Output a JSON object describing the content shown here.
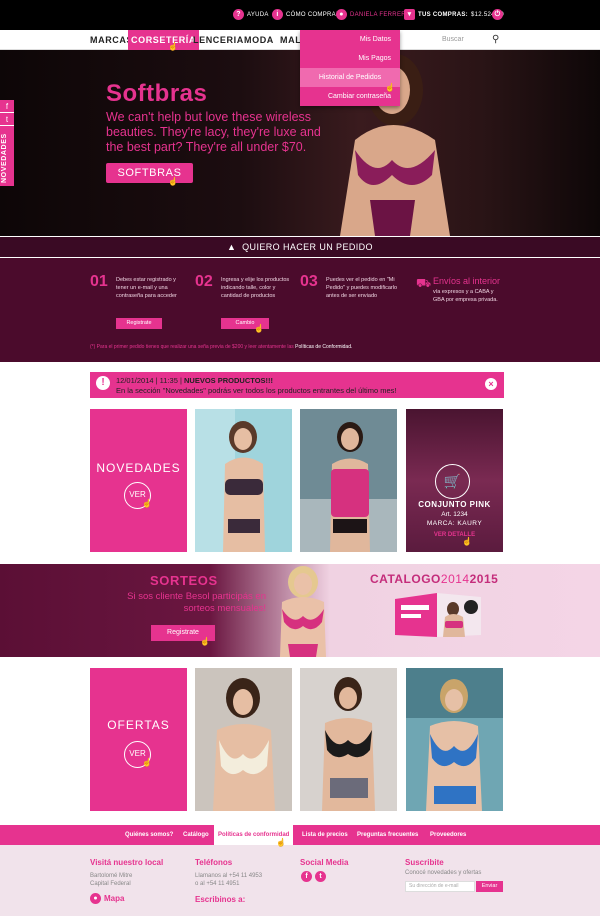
{
  "topbar": {
    "help": "AYUDA",
    "how_to_buy": "CÓMO COMPRAR",
    "user": "DANIELA FERRERO",
    "purchases_label": "TUS COMPRAS:",
    "purchases_value": "$12.524,00"
  },
  "nav": {
    "items": [
      "MARCAS",
      "CORSETERÍA",
      "LENCERIA",
      "MODA",
      "MALL"
    ],
    "search_placeholder": "Buscar"
  },
  "user_menu": {
    "items": [
      "Mis Datos",
      "Mis Pagos",
      "Historial de Pedidos",
      "Cambiar contraseña"
    ]
  },
  "hero": {
    "title": "Softbras",
    "text": "We can't help but love these wireless beauties. They're lacy, they're luxe and the best part? They're all under $70.",
    "button": "SOFTBRAS",
    "slides": 5,
    "active_slide": 2
  },
  "side_social": {
    "label": "NOVEDADES"
  },
  "order": {
    "bar_label": "QUIERO HACER UN PEDIDO",
    "steps": [
      {
        "num": "01",
        "text": "Debes estar registrado y tener un e-mail y una contraseña para acceder",
        "button": "Registrate"
      },
      {
        "num": "02",
        "text": "Ingresa y elije los productos indicando talle, color y cantidad de productos",
        "button": "Cambio"
      },
      {
        "num": "03",
        "text": "Puedes ver el pedido en \"Mi Pedido\" y puedes modificarlo antes de ser enviado",
        "button": ""
      }
    ],
    "shipping_title": "Envíos al interior",
    "shipping_text": "vía expresos y a CABA y GBA por empresa privada.",
    "note": "(*) Para el primer pedido tienes que realizar una seña previa de $200 y leer atentamente las",
    "note_link": "Políticas de Conformidad."
  },
  "alert": {
    "date": "12/01/2014 | 11:35 |",
    "title": "NUEVOS PRODUCTOS!!!",
    "text": "En la sección \"Novedades\" podrás ver todos los productos entrantes del último mes!"
  },
  "novedades": {
    "title": "NOVEDADES",
    "button": "VER",
    "featured": {
      "name": "CONJUNTO PINK",
      "art": "Art. 1234",
      "brand": "MARCA: KAURY",
      "link": "VER DETALLE"
    }
  },
  "sorteos": {
    "title": "SORTEOS",
    "text": "Si sos cliente Besol participás en sorteos mensuales!",
    "button": "Registrate",
    "catalog_a": "CATALOGO",
    "catalog_b": "2014",
    "catalog_c": "2015"
  },
  "ofertas": {
    "title": "OFERTAS",
    "button": "VER"
  },
  "footer_nav": {
    "items": [
      "Quiénes somos?",
      "Catálogo",
      "Políticas de conformidad",
      "Lista de precios",
      "Preguntas frecuentes",
      "Proveedores"
    ]
  },
  "footer": {
    "local_title": "Visitá nuestro local",
    "local_address": "Bartolomé Mitre\nCapital Federal",
    "map_label": "Mapa",
    "phones_title": "Teléfonos",
    "phones_text": "Llamanos al +54 11 4953\no al +54 11 4951",
    "write_title": "Escribinos a:",
    "social_title": "Social Media",
    "subscribe_title": "Suscribite",
    "subscribe_text": "Conocé novedades y ofertas",
    "subscribe_placeholder": "Su dirección de e-mail",
    "subscribe_button": "Enviar"
  },
  "colors": {
    "accent": "#e6338f",
    "dark_plum": "#4b0b2c",
    "footer_bg": "#f1e3eb"
  }
}
